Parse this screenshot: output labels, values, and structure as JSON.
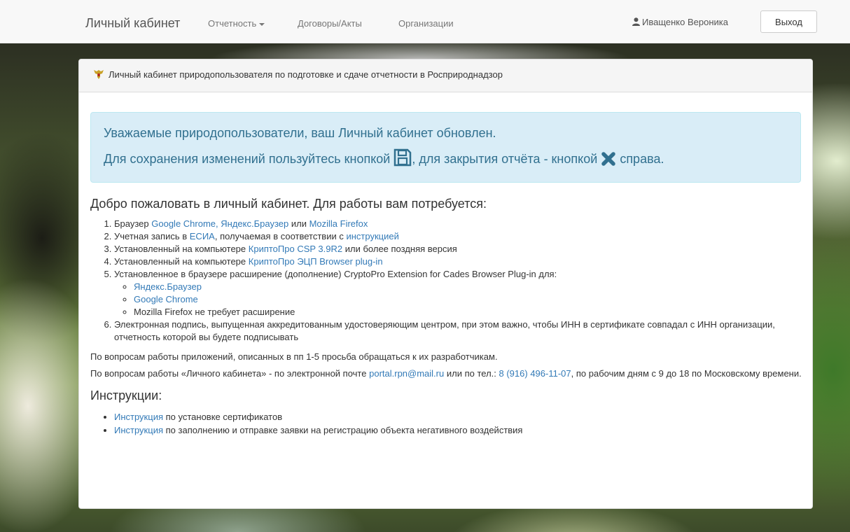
{
  "nav": {
    "brand": "Личный кабинет",
    "reports": "Отчетность",
    "contracts": "Договоры/Акты",
    "orgs": "Организации",
    "user": "Иващенко Вероника",
    "logout": "Выход"
  },
  "panel": {
    "title": "Личный кабинет природопользователя по подготовке и сдаче отчетности в Росприроднадзор"
  },
  "alert": {
    "line1": "Уважаемые природопользователи, ваш Личный кабинет обновлен.",
    "line2_a": "Для сохранения изменений пользуйтесь кнопкой",
    "line2_b": ", для закрытия отчёта - кнопкой",
    "line2_c": "справа."
  },
  "welcome": "Добро пожаловать в личный кабинет. Для работы вам потребуется:",
  "req": {
    "r1_pre": "Браузер",
    "r1_chrome": "Google Chrome,",
    "r1_yandex": "Яндекс.Браузер",
    "r1_or": "или",
    "r1_firefox": "Mozilla Firefox",
    "r2_pre": "Учетная запись в",
    "r2_esia": "ЕСИА",
    "r2_mid": ", получаемая в соответствии с",
    "r2_link": "инструкцией",
    "r3_pre": "Установленный на компьютере",
    "r3_link": "КриптоПро CSP 3.9R2",
    "r3_post": "или более поздняя версия",
    "r4_pre": "Установленный на компьютере",
    "r4_link": "КриптоПро ЭЦП Browser plug-in",
    "r5_text": "Установленное в браузере расширение (дополнение) CryptoPro Extension for Cades Browser Plug-in для:",
    "r5_sub1": "Яндекс.Браузер",
    "r5_sub2": "Google Chrome",
    "r5_sub3": "Mozilla Firefox не требует расширение",
    "r6_text": "Электронная подпись, выпущенная аккредитованным удостоверяющим центром, при этом важно, чтобы ИНН в сертификате совпадал с ИНН организации, отчетность которой вы будете подписывать"
  },
  "info1": "По вопросам работы приложений, описанных в пп 1-5 просьба обращаться к их разработчикам.",
  "info2": {
    "pre": "По вопросам работы «Личного кабинета» - по электронной почте",
    "email": "portal.rpn@mail.ru",
    "mid": "или по тел.:",
    "phone": "8 (916) 496-11-07",
    "post": ", по рабочим дням с 9 до 18 по Московскому времени."
  },
  "instructions": {
    "title": "Инструкции:",
    "items": [
      {
        "link": "Инструкция",
        "text": "по установке сертификатов"
      },
      {
        "link": "Инструкция",
        "text": "по заполнению и отправке заявки на регистрацию объекта негативного воздействия"
      }
    ]
  }
}
